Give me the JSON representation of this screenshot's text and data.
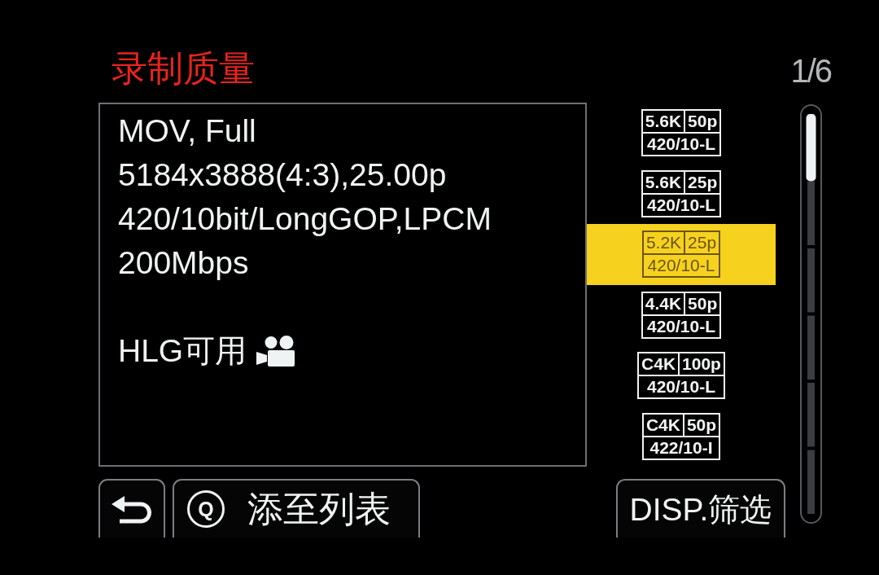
{
  "title": "录制质量",
  "page_indicator": "1/6",
  "details": {
    "lines": [
      "MOV, Full",
      "5184x3888(4:3),25.00p",
      "420/10bit/LongGOP,LPCM",
      "200Mbps"
    ],
    "hlg_note": "HLG可用"
  },
  "formats": [
    {
      "resolution": "5.6K",
      "frame_rate": "50p",
      "codec": "420/10-L",
      "selected": false
    },
    {
      "resolution": "5.6K",
      "frame_rate": "25p",
      "codec": "420/10-L",
      "selected": false
    },
    {
      "resolution": "5.2K",
      "frame_rate": "25p",
      "codec": "420/10-L",
      "selected": true
    },
    {
      "resolution": "4.4K",
      "frame_rate": "50p",
      "codec": "420/10-L",
      "selected": false
    },
    {
      "resolution": "C4K",
      "frame_rate": "100p",
      "codec": "420/10-L",
      "selected": false
    },
    {
      "resolution": "C4K",
      "frame_rate": "50p",
      "codec": "422/10-I",
      "selected": false
    }
  ],
  "buttons": [
    {
      "kind": "back"
    },
    {
      "kind": "key",
      "key": "Q",
      "label": "添至列表"
    },
    {
      "kind": "text",
      "label": "DISP.筛选"
    }
  ]
}
